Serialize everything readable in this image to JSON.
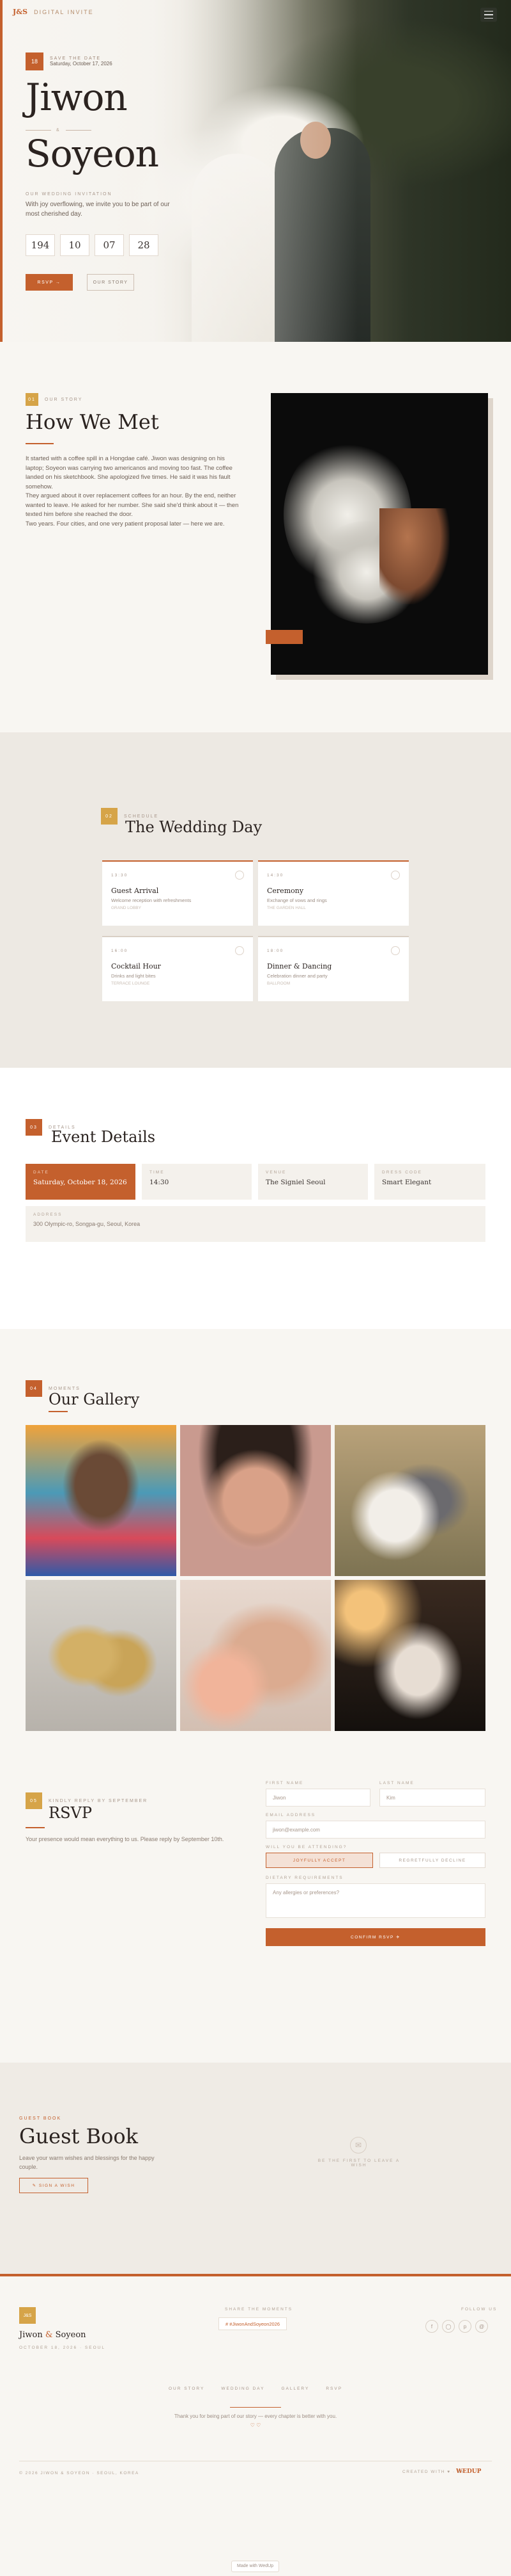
{
  "topbar": {
    "logo": "J&S",
    "brand": "DIGITAL INVITE"
  },
  "hero": {
    "date_box": "18",
    "date_label": "SAVE THE DATE",
    "date_value": "Saturday, October 17, 2026",
    "first_name": "Jiwon",
    "second_name": "Soyeon",
    "amp": "&",
    "tag": "OUR WEDDING INVITATION",
    "desc": "With joy overflowing, we invite you to be part of our most cherished day.",
    "countdown": [
      "194",
      "10",
      "07",
      "28"
    ],
    "rsvp_btn": "RSVP →",
    "story_btn": "OUR STORY"
  },
  "story": {
    "num": "01",
    "kicker": "OUR STORY",
    "title": "How We Met",
    "paragraphs": [
      "It started with a coffee spill in a Hongdae café. Jiwon was designing on his laptop; Soyeon was carrying two americanos and moving too fast. The coffee landed on his sketchbook. She apologized five times. He said it was his fault somehow.",
      "They argued about it over replacement coffees for an hour. By the end, neither wanted to leave. He asked for her number. She said she'd think about it — then texted him before she reached the door.",
      "Two years. Four cities, and one very patient proposal later — here we are."
    ]
  },
  "day": {
    "num": "02",
    "kicker": "SCHEDULE",
    "title": "The Wedding Day",
    "cards": [
      {
        "time": "13:30",
        "name": "Guest Arrival",
        "desc": "Welcome reception with refreshments",
        "meta": "GRAND LOBBY"
      },
      {
        "time": "14:30",
        "name": "Ceremony",
        "desc": "Exchange of vows and rings",
        "meta": "THE GARDEN HALL"
      },
      {
        "time": "16:00",
        "name": "Cocktail Hour",
        "desc": "Drinks and light bites",
        "meta": "TERRACE LOUNGE"
      },
      {
        "time": "18:00",
        "name": "Dinner & Dancing",
        "desc": "Celebration dinner and party",
        "meta": "BALLROOM"
      }
    ]
  },
  "event": {
    "num": "03",
    "kicker": "DETAILS",
    "title": "Event Details",
    "items": [
      {
        "label": "DATE",
        "value": "Saturday, October 18, 2026"
      },
      {
        "label": "TIME",
        "value": "14:30"
      },
      {
        "label": "VENUE",
        "value": "The Signiel Seoul"
      },
      {
        "label": "DRESS CODE",
        "value": "Smart Elegant"
      }
    ],
    "address_label": "ADDRESS",
    "address": "300 Olympic-ro, Songpa-gu, Seoul, Korea"
  },
  "gallery": {
    "num": "04",
    "kicker": "MOMENTS",
    "title": "Our Gallery"
  },
  "rsvp": {
    "num": "05",
    "kicker": "KINDLY REPLY BY SEPTEMBER",
    "title": "RSVP",
    "desc": "Your presence would mean everything to us. Please reply by September 10th.",
    "first_label": "FIRST NAME",
    "first_ph": "Jiwon",
    "last_label": "LAST NAME",
    "last_ph": "Kim",
    "email_label": "EMAIL ADDRESS",
    "email_ph": "jiwon@example.com",
    "attend_label": "WILL YOU BE ATTENDING?",
    "accept": "JOYFULLY ACCEPT",
    "decline": "REGRETFULLY DECLINE",
    "diet_label": "DIETARY REQUIREMENTS",
    "diet_ph": "Any allergies or preferences?",
    "submit": "CONFIRM RSVP ✈"
  },
  "guest": {
    "kicker": "GUEST BOOK",
    "title": "Guest Book",
    "desc": "Leave your warm wishes and blessings for the happy couple.",
    "btn": "✎ SIGN A WISH",
    "empty": "BE THE FIRST TO LEAVE A WISH"
  },
  "footer": {
    "box": "J&S",
    "name_a": "Jiwon",
    "amp": "&",
    "name_b": "Soyeon",
    "sub": "OCTOBER 18, 2026 · SEOUL",
    "hashtag_label": "SHARE THE MOMENTS",
    "hashtag": "# #JiwonAndSoyeon2026",
    "follow_label": "FOLLOW US",
    "nav": [
      "OUR STORY",
      "WEDDING DAY",
      "GALLERY",
      "RSVP"
    ],
    "thanks": "Thank you for being part of our story — every chapter is better with you.",
    "hearts": "♡ ♡",
    "copy": "© 2026 JIWON & SOYEON · SEOUL, KOREA",
    "made": "CREATED WITH ♥ · BY",
    "wedup": "WEDUP"
  },
  "badge": {
    "text": "Made with WedUp"
  },
  "colors": {
    "accent": "#c4602d",
    "gold": "#d6a448",
    "bg": "#f8f6f2"
  }
}
